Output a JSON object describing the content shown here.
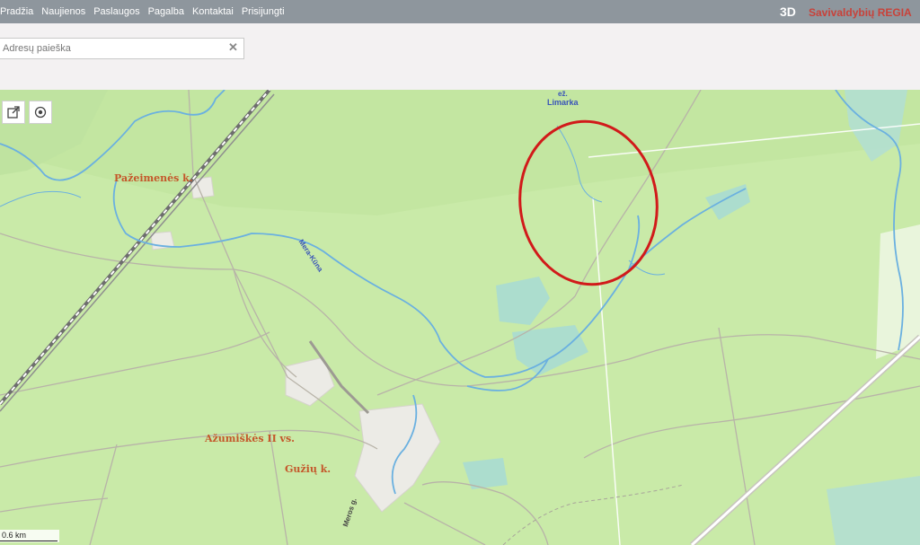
{
  "nav": [
    "Pradžia",
    "Naujienos",
    "Paslaugos",
    "Pagalba",
    "Kontaktai",
    "Prisijungti"
  ],
  "brand": {
    "mode": "3D",
    "name": "Savivaldybių REGIA"
  },
  "search": {
    "placeholder": "Adresų paieška"
  },
  "map": {
    "places": [
      "Pažeimenės k.",
      "Ažumiškės II vs.",
      "Gužių k."
    ],
    "water": {
      "lake_prefix": "ež.",
      "lake_name": "Limarka",
      "river": "Mera-Kūna"
    },
    "road": "Meros g.",
    "scale": "0.6 km",
    "highlight_color": "#d11a1a"
  }
}
